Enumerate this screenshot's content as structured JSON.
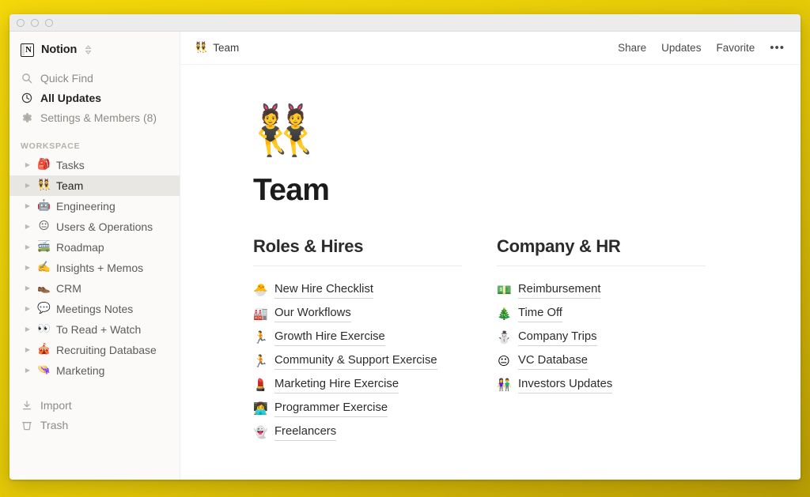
{
  "window": {
    "traffic_lights": [
      "close",
      "minimize",
      "zoom"
    ]
  },
  "sidebar": {
    "workspace": {
      "name": "Notion",
      "logo_icon": "notion-book-icon",
      "switch_icon": "chevron-up-down-icon"
    },
    "nav": [
      {
        "label": "Quick Find",
        "icon": "search-icon",
        "strong": false
      },
      {
        "label": "All Updates",
        "icon": "clock-icon",
        "strong": true
      },
      {
        "label": "Settings & Members (8)",
        "icon": "gear-icon",
        "strong": false
      }
    ],
    "section_label": "WORKSPACE",
    "pages": [
      {
        "label": "Tasks",
        "emoji": "🎒",
        "selected": false
      },
      {
        "label": "Team",
        "emoji": "👯",
        "selected": true
      },
      {
        "label": "Engineering",
        "emoji": "🤖",
        "selected": false
      },
      {
        "label": "Users & Operations",
        "emoji": "😐",
        "selected": false
      },
      {
        "label": "Roadmap",
        "emoji": "🚎",
        "selected": false
      },
      {
        "label": "Insights + Memos",
        "emoji": "✍️",
        "selected": false
      },
      {
        "label": "CRM",
        "emoji": "👞",
        "selected": false
      },
      {
        "label": "Meetings Notes",
        "emoji": "💬",
        "selected": false
      },
      {
        "label": "To Read + Watch",
        "emoji": "👀",
        "selected": false
      },
      {
        "label": "Recruiting Database",
        "emoji": "🎪",
        "selected": false
      },
      {
        "label": "Marketing",
        "emoji": "👒",
        "selected": false
      }
    ],
    "bottom": [
      {
        "label": "Import",
        "icon": "download-icon"
      },
      {
        "label": "Trash",
        "icon": "trash-icon"
      }
    ]
  },
  "topbar": {
    "breadcrumb": {
      "emoji": "👯",
      "label": "Team"
    },
    "actions": [
      {
        "label": "Share"
      },
      {
        "label": "Updates"
      },
      {
        "label": "Favorite"
      }
    ],
    "more_icon": "ellipsis-icon"
  },
  "page": {
    "icon": "👯",
    "title": "Team",
    "columns": [
      {
        "heading": "Roles & Hires",
        "links": [
          {
            "emoji": "🐣",
            "label": "New Hire Checklist"
          },
          {
            "emoji": "🏭",
            "label": "Our Workflows"
          },
          {
            "emoji": "🏃",
            "label": "Growth Hire Exercise"
          },
          {
            "emoji": "🏃",
            "label": "Community & Support Exercise"
          },
          {
            "emoji": "💄",
            "label": "Marketing Hire Exercise"
          },
          {
            "emoji": "👩‍💻",
            "label": "Programmer Exercise"
          },
          {
            "emoji": "👻",
            "label": "Freelancers"
          }
        ]
      },
      {
        "heading": "Company & HR",
        "links": [
          {
            "emoji": "💵",
            "label": "Reimbursement"
          },
          {
            "emoji": "🎄",
            "label": "Time Off"
          },
          {
            "emoji": "⛄",
            "label": "Company Trips"
          },
          {
            "emoji": "😐",
            "label": "VC Database"
          },
          {
            "emoji": "👫",
            "label": "Investors Updates"
          }
        ]
      }
    ]
  },
  "colors": {
    "desktop_yellow_top": "#f5d90a",
    "desktop_yellow_bottom": "#b99e05",
    "sidebar_bg": "#fbfaf9",
    "selected_row_bg": "#e8e7e4",
    "content_bg": "#ffffff",
    "text_primary": "#1c1c1c",
    "text_muted": "#8d8b86"
  }
}
